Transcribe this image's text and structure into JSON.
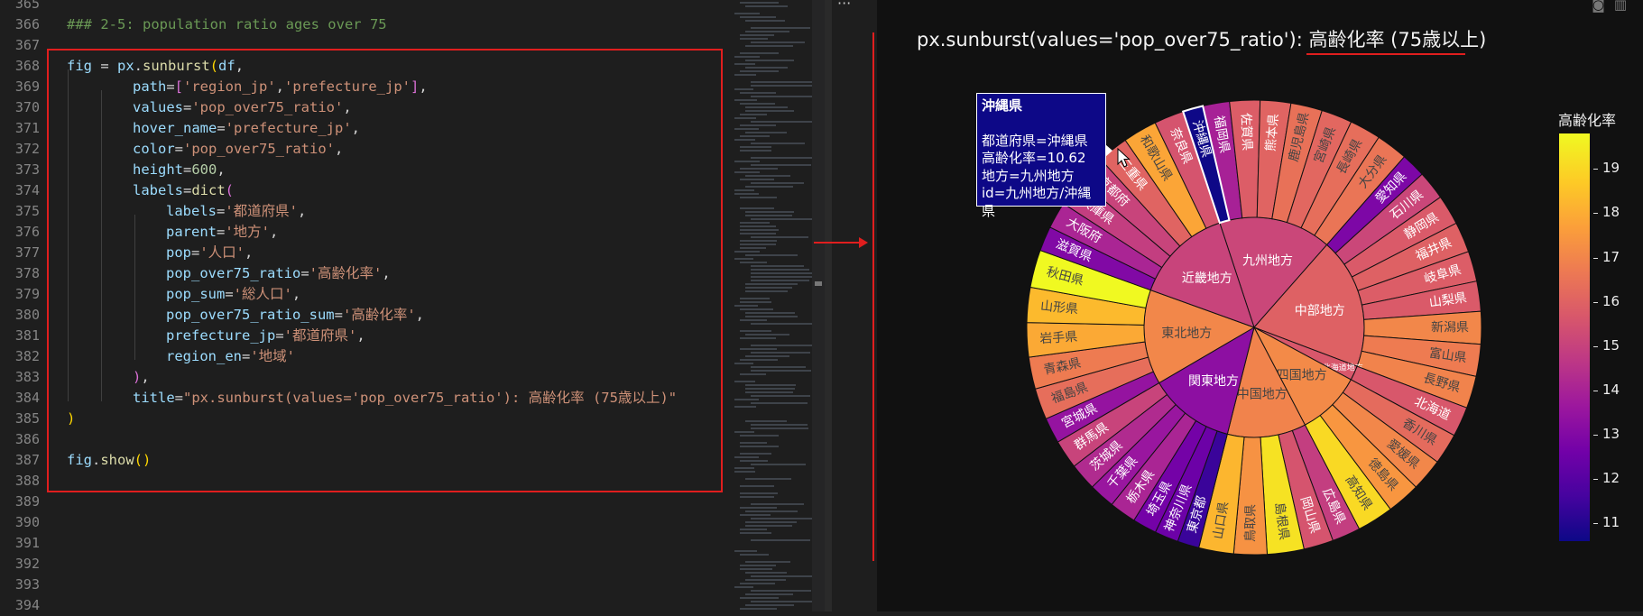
{
  "editor": {
    "line_numbers": [
      "365",
      "366",
      "367",
      "368",
      "369",
      "370",
      "371",
      "372",
      "373",
      "374",
      "375",
      "376",
      "377",
      "378",
      "379",
      "380",
      "381",
      "382",
      "383",
      "384",
      "385",
      "386",
      "387",
      "388",
      "389",
      "390",
      "391",
      "392",
      "393",
      "394"
    ],
    "comment": "### 2-5: population ratio ages over 75",
    "code": {
      "fig": "fig",
      "eq": " = ",
      "px": "px",
      "sunburst": "sunburst",
      "df": "df",
      "path_kw": "path",
      "path_v1": "'region_jp'",
      "path_v2": "'prefecture_jp'",
      "values_kw": "values",
      "values_v": "'pop_over75_ratio'",
      "hover_kw": "hover_name",
      "hover_v": "'prefecture_jp'",
      "color_kw": "color",
      "color_v": "'pop_over75_ratio'",
      "height_kw": "height",
      "height_v": "600",
      "labels_kw": "labels",
      "dict": "dict",
      "l1_kw": "labels",
      "l1_v": "'都道府県'",
      "l2_kw": "parent",
      "l2_v": "'地方'",
      "l3_kw": "pop",
      "l3_v": "'人口'",
      "l4_kw": "pop_over75_ratio",
      "l4_v": "'高齢化率'",
      "l5_kw": "pop_sum",
      "l5_v": "'総人口'",
      "l6_kw": "pop_over75_ratio_sum",
      "l6_v": "'高齢化率'",
      "l7_kw": "prefecture_jp",
      "l7_v": "'都道府県'",
      "l8_kw": "region_en",
      "l8_v": "'地域'",
      "title_kw": "title",
      "title_v": "\"px.sunburst(values='pop_over75_ratio'): 高齢化率 (75歳以上)\"",
      "show": "show"
    }
  },
  "output": {
    "title_prefix": "px.sunburst(values='pop_over75_ratio'): ",
    "title_jp": "高齢化率 (75歳以上)",
    "more_icon": "ellipsis-icon",
    "toolbar_icons": [
      "camera-icon",
      "bar-chart-icon"
    ]
  },
  "tooltip": {
    "title": "沖縄県",
    "line1": "都道府県=沖縄県",
    "line2": "高齢化率=10.62",
    "line3": "地方=九州地方",
    "line4": "id=九州地方/沖縄県"
  },
  "colorbar": {
    "title": "高齢化率",
    "ticks": [
      "19",
      "18",
      "17",
      "16",
      "15",
      "14",
      "13",
      "12",
      "11"
    ],
    "colors": [
      "#0d0887",
      "#46039f",
      "#7201a8",
      "#9c179e",
      "#bd3786",
      "#d8576b",
      "#ed7953",
      "#fb9f3a",
      "#fdca26",
      "#f0f921"
    ]
  },
  "chart_data": {
    "type": "sunburst",
    "title": "px.sunburst(values='pop_over75_ratio'): 高齢化率 (75歳以上)",
    "colorbar_title": "高齢化率",
    "colorbar_range": [
      10.6,
      19.8
    ],
    "regions": [
      {
        "name": "九州地方",
        "color_value": 15.2,
        "prefectures": [
          {
            "name": "沖縄県",
            "value": 10.62
          },
          {
            "name": "福岡県",
            "value": 14.0
          },
          {
            "name": "佐賀県",
            "value": 15.9
          },
          {
            "name": "熊本県",
            "value": 16.1
          },
          {
            "name": "鹿児島県",
            "value": 16.5
          },
          {
            "name": "宮崎県",
            "value": 16.2
          },
          {
            "name": "長崎県",
            "value": 16.4
          },
          {
            "name": "大分県",
            "value": 16.6
          }
        ]
      },
      {
        "name": "中部地方",
        "color_value": 16.0,
        "prefectures": [
          {
            "name": "愛知県",
            "value": 12.9
          },
          {
            "name": "石川県",
            "value": 15.2
          },
          {
            "name": "静岡県",
            "value": 15.8
          },
          {
            "name": "福井県",
            "value": 16.0
          },
          {
            "name": "岐阜県",
            "value": 15.9
          },
          {
            "name": "山梨県",
            "value": 15.8
          },
          {
            "name": "新潟県",
            "value": 17.1
          },
          {
            "name": "富山県",
            "value": 16.8
          },
          {
            "name": "長野県",
            "value": 17.0
          }
        ]
      },
      {
        "name": "北海道地方",
        "color_value": 15.7,
        "prefectures": [
          {
            "name": "北海道",
            "value": 15.7
          }
        ]
      },
      {
        "name": "四国地方",
        "color_value": 17.2,
        "prefectures": [
          {
            "name": "香川県",
            "value": 16.3
          },
          {
            "name": "愛媛県",
            "value": 17.1
          },
          {
            "name": "徳島県",
            "value": 17.5
          },
          {
            "name": "高知県",
            "value": 19.1
          }
        ]
      },
      {
        "name": "中国地方",
        "color_value": 17.0,
        "prefectures": [
          {
            "name": "広島県",
            "value": 14.9
          },
          {
            "name": "岡山県",
            "value": 15.6
          },
          {
            "name": "島根県",
            "value": 19.3
          },
          {
            "name": "鳥取県",
            "value": 17.4
          },
          {
            "name": "山口県",
            "value": 18.3
          }
        ]
      },
      {
        "name": "関東地方",
        "color_value": 13.3,
        "prefectures": [
          {
            "name": "東京都",
            "value": 11.4
          },
          {
            "name": "神奈川県",
            "value": 12.5
          },
          {
            "name": "埼玉県",
            "value": 12.7
          },
          {
            "name": "栃木県",
            "value": 14.1
          },
          {
            "name": "千葉県",
            "value": 13.6
          },
          {
            "name": "茨城県",
            "value": 14.3
          },
          {
            "name": "群馬県",
            "value": 15.1
          }
        ]
      },
      {
        "name": "東北地方",
        "color_value": 17.1,
        "prefectures": [
          {
            "name": "宮城県",
            "value": 13.5
          },
          {
            "name": "福島県",
            "value": 16.4
          },
          {
            "name": "青森県",
            "value": 16.8
          },
          {
            "name": "岩手県",
            "value": 18.0
          },
          {
            "name": "山形県",
            "value": 18.4
          },
          {
            "name": "秋田県",
            "value": 19.8
          }
        ]
      },
      {
        "name": "近畿地方",
        "color_value": 15.1,
        "prefectures": [
          {
            "name": "滋賀県",
            "value": 13.0
          },
          {
            "name": "大阪府",
            "value": 14.1
          },
          {
            "name": "兵庫県",
            "value": 14.9
          },
          {
            "name": "京都府",
            "value": 15.1
          },
          {
            "name": "三重県",
            "value": 16.1
          },
          {
            "name": "和歌山県",
            "value": 17.9
          },
          {
            "name": "奈良県",
            "value": 15.6
          }
        ]
      }
    ]
  }
}
